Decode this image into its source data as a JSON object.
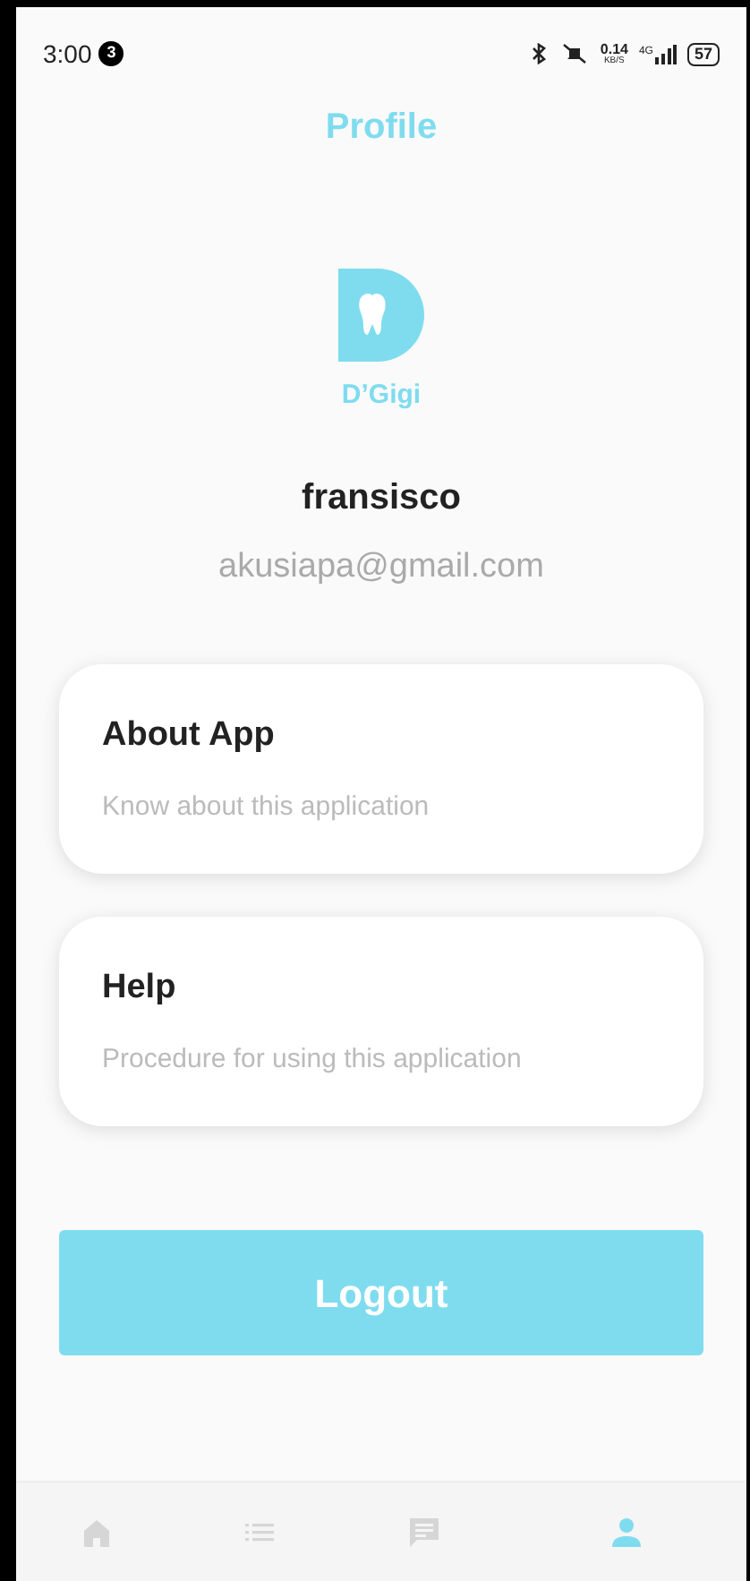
{
  "status_bar": {
    "time": "3:00",
    "notification_count": "3",
    "speed": "0.14",
    "speed_unit": "KB/S",
    "network": "4G",
    "battery": "57"
  },
  "header": {
    "title": "Profile"
  },
  "logo": {
    "name": "D’Gigi"
  },
  "user": {
    "name": "fransisco",
    "email": "akusiapa@gmail.com"
  },
  "cards": [
    {
      "title": "About App",
      "subtitle": "Know about this application"
    },
    {
      "title": "Help",
      "subtitle": "Procedure for using this application"
    }
  ],
  "logout_button": "Logout",
  "bottom_nav": [
    {
      "kind": "home",
      "selected": false
    },
    {
      "kind": "list",
      "selected": false
    },
    {
      "kind": "chat",
      "selected": false
    },
    {
      "kind": "profile",
      "selected": true
    }
  ]
}
